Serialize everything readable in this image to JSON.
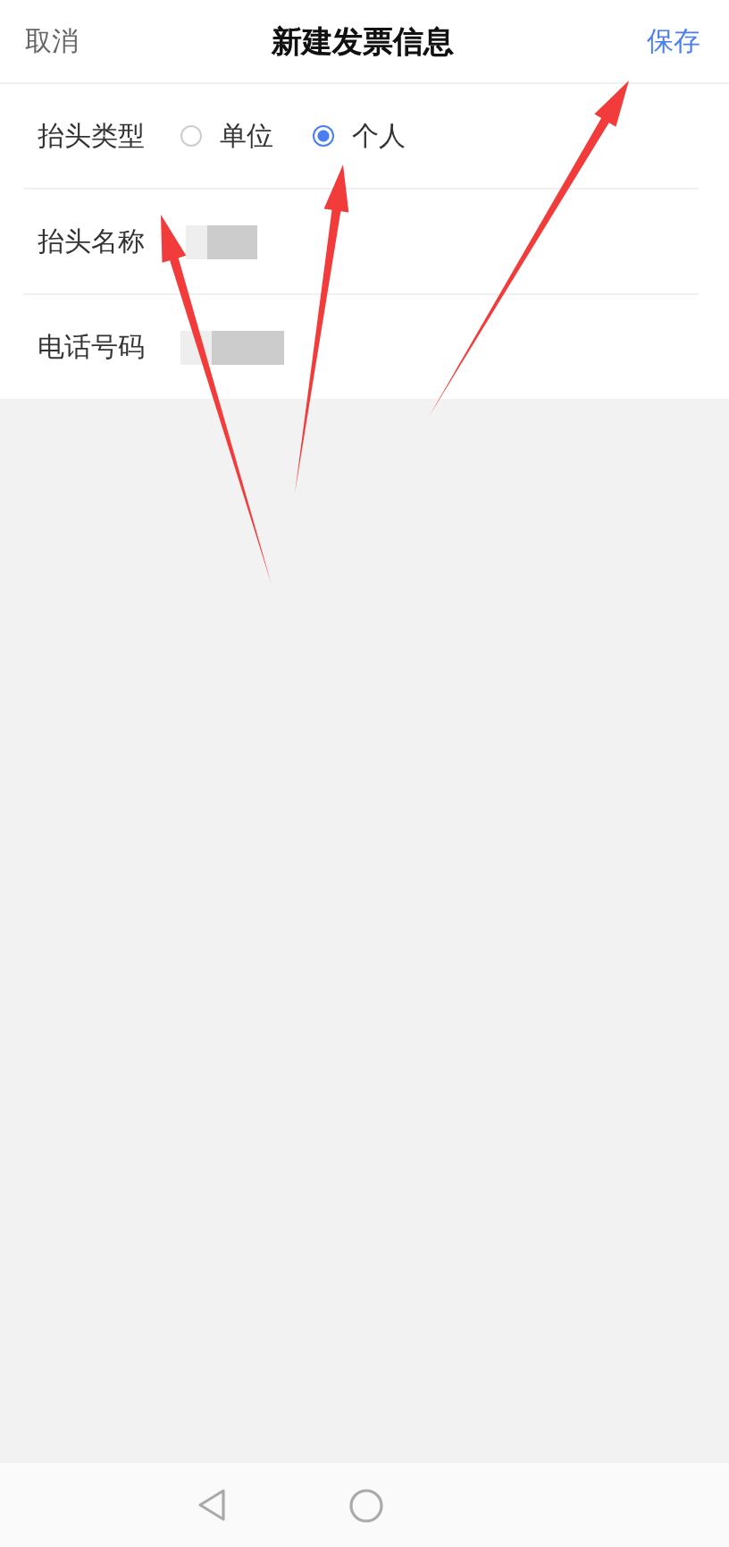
{
  "header": {
    "cancel": "取消",
    "title": "新建发票信息",
    "save": "保存"
  },
  "rows": [
    {
      "kind": "radio",
      "label": "抬头类型",
      "options": [
        {
          "label": "单位",
          "selected": false
        },
        {
          "label": "个人",
          "selected": true
        }
      ]
    },
    {
      "kind": "redacted",
      "label": "抬头名称"
    },
    {
      "kind": "redacted",
      "label": "电话号码"
    }
  ]
}
